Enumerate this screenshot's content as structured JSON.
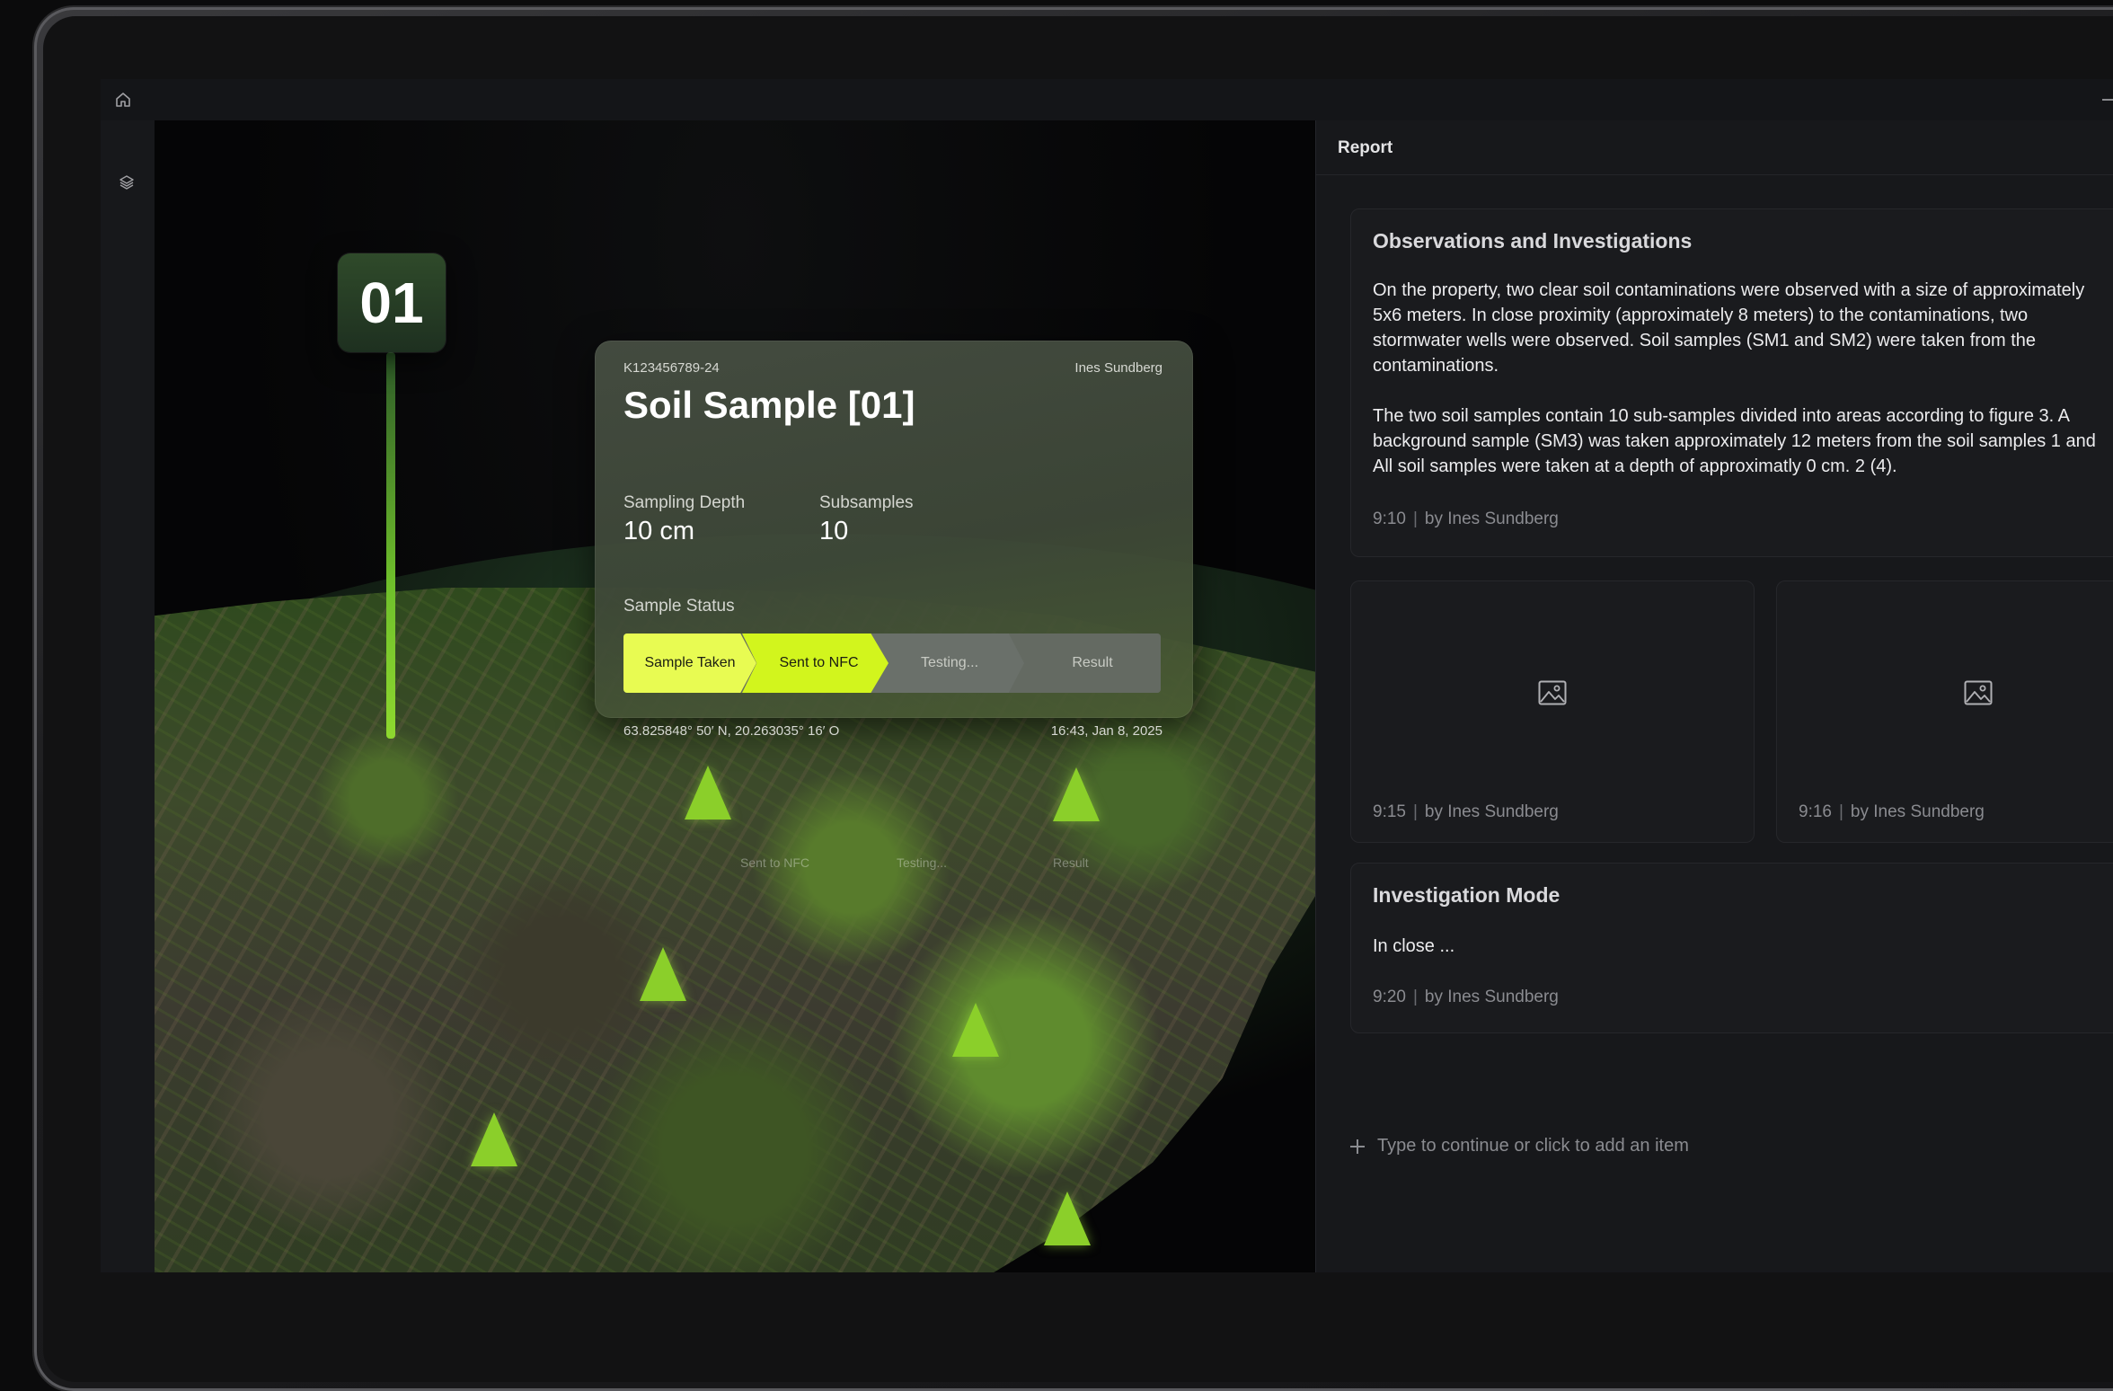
{
  "sample_card": {
    "pin_number": "01",
    "id": "K123456789-24",
    "owner": "Ines Sundberg",
    "title": "Soil Sample [01]",
    "fields": [
      {
        "label": "Sampling Depth",
        "value": "10 cm"
      },
      {
        "label": "Subsamples",
        "value": "10"
      }
    ],
    "status_label": "Sample Status",
    "status_steps": [
      "Sample Taken",
      "Sent to NFC",
      "Testing...",
      "Result"
    ],
    "coordinates": "63.825848° 50′ N, 20.263035° 16′ O",
    "timestamp": "16:43, Jan 8, 2025"
  },
  "viewport_ghost_labels": [
    "Sent to NFC",
    "Testing...",
    "Result"
  ],
  "report": {
    "title": "Report",
    "observations": {
      "heading": "Observations and Investigations",
      "paragraph_1_lines": [
        "On the property, two clear soil contaminations were observed with a size of approximately",
        "5x6 meters. In close proximity (approximately 8 meters) to the contaminations, two",
        "stormwater wells were observed. Soil samples (SM1 and SM2) were taken from the",
        "contaminations."
      ],
      "paragraph_2_lines": [
        "The two soil samples contain 10 sub-samples divided into areas according to figure 3. A",
        "background sample (SM3) was taken approximately 12 meters from the soil samples 1 and",
        "All soil samples were taken at a depth of approximatly  0 cm. 2 (4)."
      ],
      "time": "9:10",
      "author": "by Ines Sundberg"
    },
    "images": [
      {
        "icon": "image-icon",
        "time": "9:15",
        "author": "by Ines Sundberg"
      },
      {
        "icon": "image-icon",
        "time": "9:16",
        "author": "by Ines Sundberg"
      }
    ],
    "investigation": {
      "heading": "Investigation Mode",
      "text": "In close ...",
      "time": "9:20",
      "author": "by Ines Sundberg"
    },
    "add_item_placeholder": "Type to continue or click to add an item"
  },
  "colors": {
    "accent": "#d2f51d",
    "accent_light": "#e8fb52",
    "marker": "#8bcf2a"
  }
}
